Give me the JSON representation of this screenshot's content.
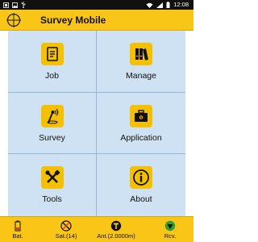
{
  "status_bar": {
    "left_icons": [
      "screenshot-icon",
      "image-icon",
      "usb-icon"
    ],
    "right_icons": [
      "wifi-icon",
      "signal-icon",
      "battery-icon"
    ],
    "time": "12:08"
  },
  "app_bar": {
    "title": "Survey Mobile",
    "logo": "crosshair-logo-icon"
  },
  "menu": {
    "items": [
      {
        "label": "Job",
        "icon": "document-icon"
      },
      {
        "label": "Manage",
        "icon": "binders-icon"
      },
      {
        "label": "Survey",
        "icon": "survey-pole-icon"
      },
      {
        "label": "Application",
        "icon": "toolbox-icon"
      },
      {
        "label": "Tools",
        "icon": "wrench-screwdriver-icon"
      },
      {
        "label": "About",
        "icon": "info-icon"
      }
    ]
  },
  "bottom_bar": {
    "items": [
      {
        "label": "Bat.",
        "icon": "battery-status-icon"
      },
      {
        "label": "Sat.(14)",
        "icon": "satellite-icon"
      },
      {
        "label": "Ant.(2.0000m)",
        "icon": "antenna-icon"
      },
      {
        "label": "Rcv.",
        "icon": "receiver-icon"
      }
    ]
  },
  "colors": {
    "accent": "#f9c517",
    "tile_background": "#cfe2f3",
    "icon_background": "#f5c000",
    "receiver_status": "#2e9e3a",
    "satellite_status": "#e53935"
  }
}
